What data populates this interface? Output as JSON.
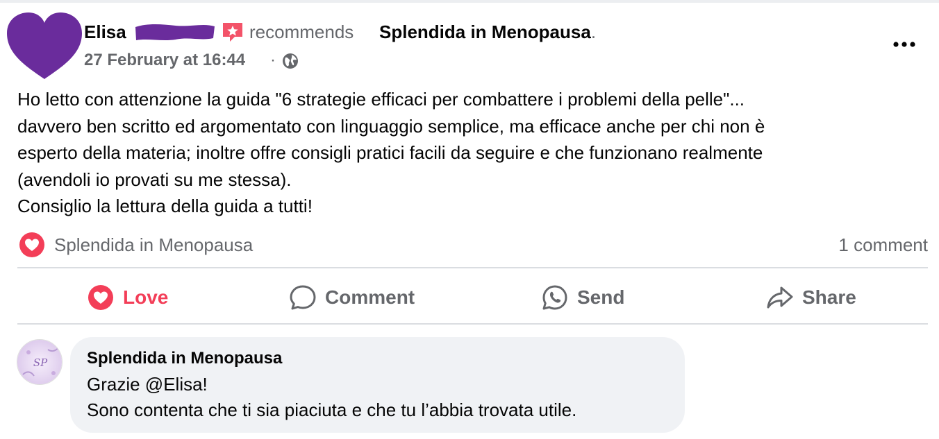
{
  "post": {
    "author_first_name": "Elisa",
    "recommends_label": "recommends",
    "page_name": "Splendida in Menopausa",
    "page_name_suffix": ".",
    "timestamp": "27 February at 16:44",
    "separator": "·",
    "audience_icon": "globe-icon",
    "body": "Ho letto con attenzione la guida \"6 strategie efficaci per combattere i problemi della pelle\"...\ndavvero ben scritto ed argomentato con linguaggio semplice, ma efficace anche per chi non è\nesperto della materia; inoltre offre consigli pratici facili da seguire e che funzionano realmente\n(avendoli io provati su me stessa).\nConsiglio la lettura della guida a tutti!"
  },
  "reactions": {
    "icon": "love-reaction-icon",
    "reactor_name": "Splendida in Menopausa",
    "comment_count": "1 comment"
  },
  "actions": [
    {
      "label": "Love",
      "icon": "heart-icon"
    },
    {
      "label": "Comment",
      "icon": "comment-bubble-icon"
    },
    {
      "label": "Send",
      "icon": "whatsapp-icon"
    },
    {
      "label": "Share",
      "icon": "share-arrow-icon"
    }
  ],
  "comment": {
    "author": "Splendida in Menopausa",
    "avatar_text": "SP",
    "text": "Grazie @Elisa!\nSono contenta che ti sia piaciuta e che tu l’abbia trovata utile."
  },
  "colors": {
    "love": "#f33e58",
    "secondary_text": "#65676b",
    "bubble": "#f0f2f5",
    "avatar_redaction": "#6a2c9c"
  }
}
